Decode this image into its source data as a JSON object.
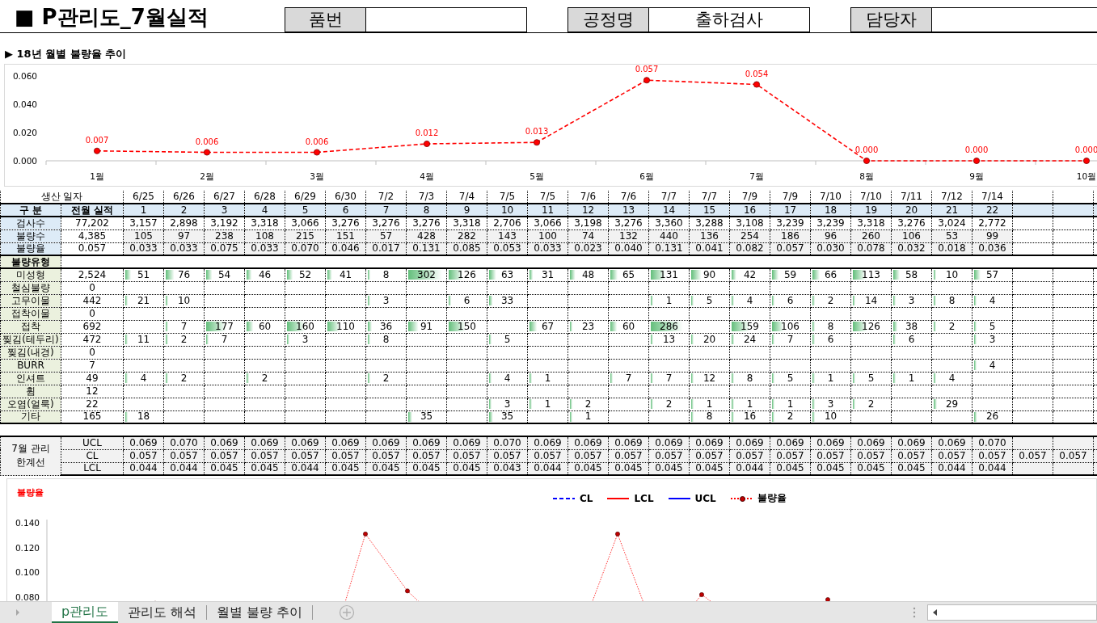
{
  "header": {
    "title": "■ P관리도_7월실적",
    "fields": [
      {
        "label": "품번"
      },
      {
        "label": "공정명",
        "value": "출하검사"
      },
      {
        "label": "담당자"
      }
    ]
  },
  "trend": {
    "title": "▶ 18년 월별 불량율 추이",
    "chart_data": {
      "type": "line",
      "categories": [
        "1월",
        "2월",
        "3월",
        "4월",
        "5월",
        "6월",
        "7월",
        "8월",
        "9월",
        "10월"
      ],
      "series": [
        {
          "color": "#ff0000",
          "line_style": "dashed",
          "marker": true,
          "values": [
            0.007,
            0.006,
            0.006,
            0.012,
            0.013,
            0.057,
            0.054,
            0.0,
            0.0,
            0.0
          ],
          "value_labels": [
            "0.007",
            "0.006",
            "0.006",
            "0.012",
            "0.013",
            "0.057",
            "0.054",
            "0.000",
            "0.000",
            "0.000"
          ]
        }
      ],
      "ylim": [
        0,
        0.06
      ],
      "yticks": [
        {
          "value": 0,
          "label": "0.000"
        },
        {
          "value": 0.02,
          "label": "0.020"
        },
        {
          "value": 0.04,
          "label": "0.040"
        },
        {
          "value": 0.06,
          "label": "0.060"
        }
      ],
      "data_labels": true
    }
  },
  "table": {
    "date_label": "생산 일자",
    "index_label": "구 분",
    "prev_label": "전월 실적",
    "dates": [
      "6/25",
      "6/26",
      "6/27",
      "6/28",
      "6/29",
      "6/30",
      "7/2",
      "7/3",
      "7/4",
      "7/5",
      "7/5",
      "7/6",
      "7/6",
      "7/7",
      "7/7",
      "7/9",
      "7/9",
      "7/10",
      "7/10",
      "7/11",
      "7/12",
      "7/14"
    ],
    "indices": [
      "1",
      "2",
      "3",
      "4",
      "5",
      "6",
      "7",
      "8",
      "9",
      "10",
      "11",
      "12",
      "13",
      "14",
      "15",
      "16",
      "17",
      "18",
      "19",
      "20",
      "21",
      "22"
    ],
    "summary_rows": [
      {
        "label": "검사수",
        "prev": "77,202",
        "values": [
          "3,157",
          "2,898",
          "3,192",
          "3,318",
          "3,066",
          "3,276",
          "3,276",
          "3,276",
          "3,318",
          "2,706",
          "3,066",
          "3,198",
          "3,276",
          "3,360",
          "3,288",
          "3,108",
          "3,239",
          "3,239",
          "3,318",
          "3,276",
          "3,024",
          "2,772"
        ]
      },
      {
        "label": "불량수",
        "prev": "4,385",
        "values": [
          "105",
          "97",
          "238",
          "108",
          "215",
          "151",
          "57",
          "428",
          "282",
          "143",
          "100",
          "74",
          "132",
          "440",
          "136",
          "254",
          "186",
          "96",
          "260",
          "106",
          "53",
          "99"
        ]
      },
      {
        "label": "불량율",
        "prev": "0.057",
        "values": [
          "0.033",
          "0.033",
          "0.075",
          "0.033",
          "0.070",
          "0.046",
          "0.017",
          "0.131",
          "0.085",
          "0.053",
          "0.033",
          "0.023",
          "0.040",
          "0.131",
          "0.041",
          "0.082",
          "0.057",
          "0.030",
          "0.078",
          "0.032",
          "0.018",
          "0.036"
        ]
      }
    ],
    "defect_header": "불량유형",
    "defect_rows": [
      {
        "label": "미성형",
        "prev": "2,524",
        "cells": [
          {
            "kind": "count",
            "value": "51"
          },
          {
            "kind": "count",
            "value": "76"
          },
          {
            "kind": "count",
            "value": "54"
          },
          {
            "kind": "count",
            "value": "46"
          },
          {
            "kind": "count",
            "value": "52"
          },
          {
            "kind": "count",
            "value": "41"
          },
          {
            "kind": "count",
            "value": "8"
          },
          {
            "kind": "count",
            "value": "302"
          },
          {
            "kind": "count",
            "value": "126"
          },
          {
            "kind": "count",
            "value": "63"
          },
          {
            "kind": "count",
            "value": "31"
          },
          {
            "kind": "count",
            "value": "48"
          },
          {
            "kind": "count",
            "value": "65"
          },
          {
            "kind": "count",
            "value": "131"
          },
          {
            "kind": "count",
            "value": "90"
          },
          {
            "kind": "count",
            "value": "42"
          },
          {
            "kind": "count",
            "value": "59"
          },
          {
            "kind": "count",
            "value": "66"
          },
          {
            "kind": "count",
            "value": "113"
          },
          {
            "kind": "count",
            "value": "58"
          },
          {
            "kind": "count",
            "value": "10"
          },
          {
            "kind": "count",
            "value": "57"
          }
        ]
      },
      {
        "label": "철심불량",
        "prev": "0"
      },
      {
        "label": "고무이물",
        "prev": "442",
        "cells": [
          {
            "kind": "count",
            "value": "21"
          },
          {
            "kind": "count",
            "value": "10"
          },
          {
            "kind": "blank"
          },
          {
            "kind": "blank"
          },
          {
            "kind": "blank"
          },
          {
            "kind": "blank"
          },
          {
            "kind": "count",
            "value": "3"
          },
          {
            "kind": "blank"
          },
          {
            "kind": "count",
            "value": "6"
          },
          {
            "kind": "count",
            "value": "33"
          },
          {
            "kind": "blank"
          },
          {
            "kind": "blank"
          },
          {
            "kind": "blank"
          },
          {
            "kind": "count",
            "value": "1"
          },
          {
            "kind": "count",
            "value": "5"
          },
          {
            "kind": "count",
            "value": "4"
          },
          {
            "kind": "count",
            "value": "6"
          },
          {
            "kind": "count",
            "value": "2"
          },
          {
            "kind": "count",
            "value": "14"
          },
          {
            "kind": "count",
            "value": "3"
          },
          {
            "kind": "count",
            "value": "8"
          },
          {
            "kind": "count",
            "value": "4"
          }
        ]
      },
      {
        "label": "접착이물",
        "prev": "0"
      },
      {
        "label": "접착",
        "prev": "692",
        "cells": [
          {
            "kind": "blank"
          },
          {
            "kind": "count",
            "value": "7"
          },
          {
            "kind": "count",
            "value": "177"
          },
          {
            "kind": "count",
            "value": "60"
          },
          {
            "kind": "count",
            "value": "160"
          },
          {
            "kind": "count",
            "value": "110"
          },
          {
            "kind": "count",
            "value": "36"
          },
          {
            "kind": "count",
            "value": "91"
          },
          {
            "kind": "count",
            "value": "150"
          },
          {
            "kind": "blank"
          },
          {
            "kind": "count",
            "value": "67"
          },
          {
            "kind": "count",
            "value": "23"
          },
          {
            "kind": "count",
            "value": "60"
          },
          {
            "kind": "count",
            "value": "286"
          },
          {
            "kind": "blank"
          },
          {
            "kind": "count",
            "value": "159"
          },
          {
            "kind": "count",
            "value": "106"
          },
          {
            "kind": "count",
            "value": "8"
          },
          {
            "kind": "count",
            "value": "126"
          },
          {
            "kind": "count",
            "value": "38"
          },
          {
            "kind": "count",
            "value": "2"
          },
          {
            "kind": "count",
            "value": "5"
          }
        ]
      },
      {
        "label": "찢김(테두리)",
        "prev": "472",
        "cells": [
          {
            "kind": "count",
            "value": "11"
          },
          {
            "kind": "count",
            "value": "2"
          },
          {
            "kind": "count",
            "value": "7"
          },
          {
            "kind": "blank"
          },
          {
            "kind": "count",
            "value": "3"
          },
          {
            "kind": "blank"
          },
          {
            "kind": "count",
            "value": "8"
          },
          {
            "kind": "blank"
          },
          {
            "kind": "blank"
          },
          {
            "kind": "count",
            "value": "5"
          },
          {
            "kind": "blank"
          },
          {
            "kind": "blank"
          },
          {
            "kind": "blank"
          },
          {
            "kind": "count",
            "value": "13"
          },
          {
            "kind": "count",
            "value": "20"
          },
          {
            "kind": "count",
            "value": "24"
          },
          {
            "kind": "count",
            "value": "7"
          },
          {
            "kind": "count",
            "value": "6"
          },
          {
            "kind": "blank"
          },
          {
            "kind": "count",
            "value": "6"
          },
          {
            "kind": "blank"
          },
          {
            "kind": "count",
            "value": "3"
          }
        ]
      },
      {
        "label": "찢김(내경)",
        "prev": "0"
      },
      {
        "label": "BURR",
        "prev": "7",
        "cells": [
          {
            "kind": "blank"
          },
          {
            "kind": "blank"
          },
          {
            "kind": "blank"
          },
          {
            "kind": "blank"
          },
          {
            "kind": "blank"
          },
          {
            "kind": "blank"
          },
          {
            "kind": "blank"
          },
          {
            "kind": "blank"
          },
          {
            "kind": "blank"
          },
          {
            "kind": "blank"
          },
          {
            "kind": "blank"
          },
          {
            "kind": "blank"
          },
          {
            "kind": "blank"
          },
          {
            "kind": "blank"
          },
          {
            "kind": "blank"
          },
          {
            "kind": "blank"
          },
          {
            "kind": "blank"
          },
          {
            "kind": "blank"
          },
          {
            "kind": "blank"
          },
          {
            "kind": "blank"
          },
          {
            "kind": "blank"
          },
          {
            "kind": "count",
            "value": "4"
          }
        ]
      },
      {
        "label": "인셔트",
        "prev": "49",
        "cells": [
          {
            "kind": "count",
            "value": "4"
          },
          {
            "kind": "count",
            "value": "2"
          },
          {
            "kind": "blank"
          },
          {
            "kind": "count",
            "value": "2"
          },
          {
            "kind": "blank"
          },
          {
            "kind": "blank"
          },
          {
            "kind": "count",
            "value": "2"
          },
          {
            "kind": "blank"
          },
          {
            "kind": "blank"
          },
          {
            "kind": "count",
            "value": "4"
          },
          {
            "kind": "count",
            "value": "1"
          },
          {
            "kind": "blank"
          },
          {
            "kind": "count",
            "value": "7"
          },
          {
            "kind": "count",
            "value": "7"
          },
          {
            "kind": "count",
            "value": "12"
          },
          {
            "kind": "count",
            "value": "8"
          },
          {
            "kind": "count",
            "value": "5"
          },
          {
            "kind": "count",
            "value": "1"
          },
          {
            "kind": "count",
            "value": "5"
          },
          {
            "kind": "count",
            "value": "1"
          },
          {
            "kind": "count",
            "value": "4"
          }
        ]
      },
      {
        "label": "휨",
        "prev": "12"
      },
      {
        "label": "오염(얼룩)",
        "prev": "22",
        "cells": [
          {
            "kind": "blank"
          },
          {
            "kind": "blank"
          },
          {
            "kind": "blank"
          },
          {
            "kind": "blank"
          },
          {
            "kind": "blank"
          },
          {
            "kind": "blank"
          },
          {
            "kind": "blank"
          },
          {
            "kind": "blank"
          },
          {
            "kind": "blank"
          },
          {
            "kind": "count",
            "value": "3"
          },
          {
            "kind": "count",
            "value": "1"
          },
          {
            "kind": "count",
            "value": "2"
          },
          {
            "kind": "blank"
          },
          {
            "kind": "count",
            "value": "2"
          },
          {
            "kind": "count",
            "value": "1"
          },
          {
            "kind": "count",
            "value": "1"
          },
          {
            "kind": "count",
            "value": "1"
          },
          {
            "kind": "count",
            "value": "3"
          },
          {
            "kind": "count",
            "value": "2"
          },
          {
            "kind": "blank"
          },
          {
            "kind": "count",
            "value": "29"
          }
        ]
      },
      {
        "label": "기타",
        "prev": "165",
        "cells": [
          {
            "kind": "count",
            "value": "18"
          },
          {
            "kind": "blank"
          },
          {
            "kind": "blank"
          },
          {
            "kind": "blank"
          },
          {
            "kind": "blank"
          },
          {
            "kind": "blank"
          },
          {
            "kind": "blank"
          },
          {
            "kind": "count",
            "value": "35"
          },
          {
            "kind": "blank"
          },
          {
            "kind": "count",
            "value": "35"
          },
          {
            "kind": "blank"
          },
          {
            "kind": "count",
            "value": "1"
          },
          {
            "kind": "blank"
          },
          {
            "kind": "blank"
          },
          {
            "kind": "count",
            "value": "8"
          },
          {
            "kind": "count",
            "value": "16"
          },
          {
            "kind": "count",
            "value": "2"
          },
          {
            "kind": "count",
            "value": "10"
          },
          {
            "kind": "blank"
          },
          {
            "kind": "blank"
          },
          {
            "kind": "blank"
          },
          {
            "kind": "count",
            "value": "26"
          }
        ]
      }
    ],
    "limits": {
      "label": "7월 관리 한계선",
      "rows": [
        {
          "name": "UCL",
          "values": [
            "0.069",
            "0.070",
            "0.069",
            "0.069",
            "0.069",
            "0.069",
            "0.069",
            "0.069",
            "0.069",
            "0.070",
            "0.069",
            "0.069",
            "0.069",
            "0.069",
            "0.069",
            "0.069",
            "0.069",
            "0.069",
            "0.069",
            "0.069",
            "0.069",
            "0.070"
          ]
        },
        {
          "name": "CL",
          "values": [
            "0.057",
            "0.057",
            "0.057",
            "0.057",
            "0.057",
            "0.057",
            "0.057",
            "0.057",
            "0.057",
            "0.057",
            "0.057",
            "0.057",
            "0.057",
            "0.057",
            "0.057",
            "0.057",
            "0.057",
            "0.057",
            "0.057",
            "0.057",
            "0.057",
            "0.057",
            "0.057",
            "0.057"
          ]
        },
        {
          "name": "LCL",
          "values": [
            "0.044",
            "0.044",
            "0.045",
            "0.045",
            "0.044",
            "0.045",
            "0.045",
            "0.045",
            "0.045",
            "0.043",
            "0.044",
            "0.045",
            "0.045",
            "0.045",
            "0.045",
            "0.044",
            "0.045",
            "0.045",
            "0.045",
            "0.045",
            "0.044",
            "0.044"
          ]
        }
      ]
    }
  },
  "p_chart": {
    "title": "불량율",
    "legend": [
      {
        "name": "CL",
        "color": "#0000ff",
        "kind": "dashed"
      },
      {
        "name": "LCL",
        "color": "#ff0000",
        "kind": "solid"
      },
      {
        "name": "UCL",
        "color": "#0000ff",
        "kind": "solid"
      },
      {
        "name": "불량율",
        "color": "#ff0000",
        "kind": "dotted"
      }
    ],
    "y_tick_labels": [
      "0.140",
      "0.120",
      "0.100",
      "0.080"
    ]
  },
  "sheet_tabs": [
    {
      "label": "p관리도",
      "selected": true
    },
    {
      "label": "관리도 해석",
      "selected": false
    },
    {
      "label": "월별 불량 추이",
      "selected": false
    }
  ]
}
